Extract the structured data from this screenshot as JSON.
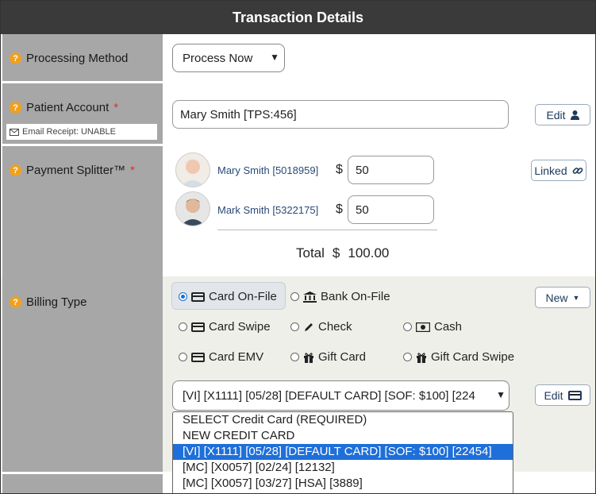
{
  "header": {
    "title": "Transaction Details"
  },
  "processing": {
    "label": "Processing Method",
    "selected": "Process Now"
  },
  "patient_account": {
    "label": "Patient Account",
    "required_mark": "*",
    "value": "Mary Smith [TPS:456]",
    "edit_label": "Edit",
    "email_receipt": "Email Receipt: UNABLE"
  },
  "splitter": {
    "label": "Payment Splitter™",
    "required_mark": "*",
    "linked_label": "Linked",
    "patients": [
      {
        "name": "Mary Smith [5018959]",
        "currency": "$",
        "amount": "50"
      },
      {
        "name": "Mark Smith [5322175]",
        "currency": "$",
        "amount": "50"
      }
    ],
    "total_label": "Total",
    "total_currency": "$",
    "total_value": "100.00"
  },
  "billing": {
    "label": "Billing Type",
    "new_label": "New",
    "edit_label": "Edit",
    "options": [
      {
        "label": "Card On-File",
        "icon": "credit-card-icon",
        "checked": true
      },
      {
        "label": "Bank On-File",
        "icon": "bank-icon",
        "checked": false
      },
      {
        "label": "Card Swipe",
        "icon": "credit-card-icon",
        "checked": false
      },
      {
        "label": "Check",
        "icon": "pen-icon",
        "checked": false
      },
      {
        "label": "Cash",
        "icon": "money-bill-icon",
        "checked": false
      },
      {
        "label": "Card EMV",
        "icon": "credit-card-icon",
        "checked": false
      },
      {
        "label": "Gift Card",
        "icon": "gift-icon",
        "checked": false
      },
      {
        "label": "Gift Card Swipe",
        "icon": "gift-icon",
        "checked": false
      }
    ],
    "card_select_value": "[VI] [X1111] [05/28] [DEFAULT CARD] [SOF: $100] [224",
    "card_options": [
      "SELECT Credit Card (REQUIRED)",
      "NEW CREDIT CARD",
      "[VI] [X1111] [05/28] [DEFAULT CARD] [SOF: $100] [22454]",
      "[MC] [X0057] [02/24] [12132]",
      "[MC] [X0057] [03/27] [HSA] [3889]"
    ],
    "card_selected_index": 2
  }
}
